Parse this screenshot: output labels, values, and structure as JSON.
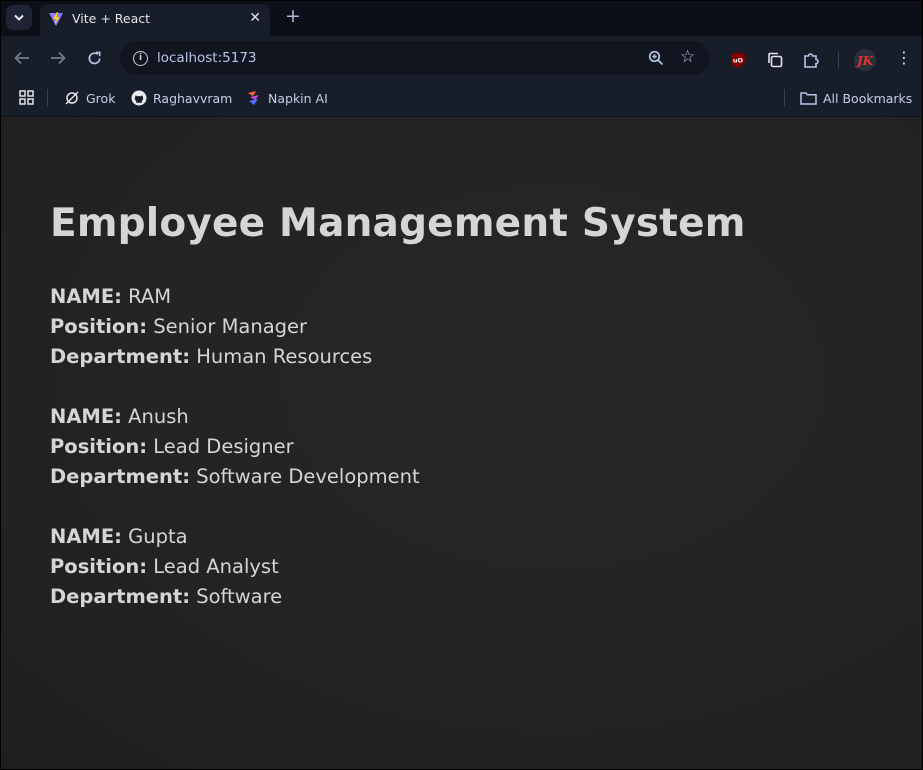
{
  "browser": {
    "tab_title": "Vite + React",
    "url": "localhost:5173",
    "bookmarks": [
      {
        "label": "Grok",
        "icon": "grok-icon"
      },
      {
        "label": "Raghavvram",
        "icon": "github-icon"
      },
      {
        "label": "Napkin AI",
        "icon": "napkin-icon"
      }
    ],
    "all_bookmarks": "All Bookmarks"
  },
  "page": {
    "title": "Employee Management System",
    "labels": {
      "name": "NAME:",
      "position": "Position:",
      "department": "Department:"
    },
    "employees": [
      {
        "name": "RAM",
        "position": "Senior Manager",
        "department": "Human Resources"
      },
      {
        "name": "Anush",
        "position": "Lead Designer",
        "department": "Software Development"
      },
      {
        "name": "Gupta",
        "position": "Lead Analyst",
        "department": "Software"
      }
    ]
  },
  "colors": {
    "page_bg": "#242424",
    "text": "#d5d5d5",
    "chrome_bg": "#181d2a",
    "link_text": "#c3cfe9"
  }
}
